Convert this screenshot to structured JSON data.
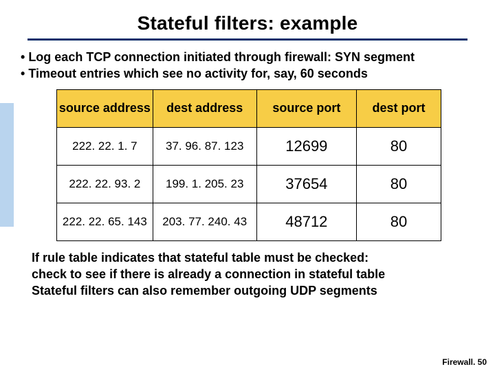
{
  "title": "Stateful filters: example",
  "bullets": [
    "Log each TCP connection initiated through firewall: SYN segment",
    "Timeout entries which see no activity for, say, 60 seconds"
  ],
  "table": {
    "headers": {
      "sa": "source address",
      "da": "dest address",
      "sp": "source port",
      "dp": "dest port"
    },
    "rows": [
      {
        "sa": "222. 22. 1. 7",
        "da": "37. 96. 87. 123",
        "sp": "12699",
        "dp": "80"
      },
      {
        "sa": "222. 22. 93. 2",
        "da": "199. 1. 205. 23",
        "sp": "37654",
        "dp": "80"
      },
      {
        "sa": "222. 22. 65. 143",
        "da": "203. 77. 240. 43",
        "sp": "48712",
        "dp": "80"
      }
    ]
  },
  "closing": [
    "If rule table indicates that stateful table must be checked:",
    "check to see if there is already a connection in stateful table",
    "Stateful filters can also remember outgoing UDP segments"
  ],
  "footer": "Firewall. 50"
}
